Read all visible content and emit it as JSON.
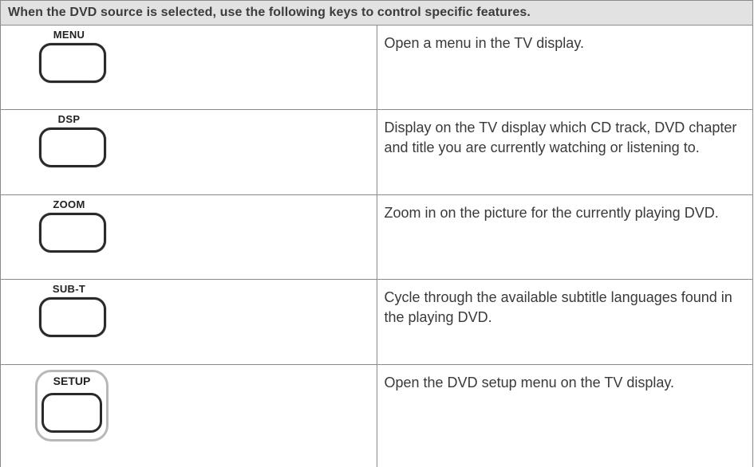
{
  "header": {
    "title": "When the DVD source is selected, use the following keys to control specific features."
  },
  "rows": [
    {
      "key": "MENU",
      "icon": "menu-key-icon",
      "description": "Open a menu in the TV display."
    },
    {
      "key": "DSP",
      "icon": "dsp-key-icon",
      "description": "Display on the TV display which CD track, DVD chapter and title you are currently watching or listening to."
    },
    {
      "key": "ZOOM",
      "icon": "zoom-key-icon",
      "description": "Zoom in on the picture for the currently playing DVD."
    },
    {
      "key": "SUB-T",
      "icon": "subt-key-icon",
      "description": "Cycle through the available subtitle languages found in the playing DVD."
    },
    {
      "key": "SETUP",
      "icon": "setup-key-icon",
      "description": "Open the DVD setup menu on the TV display."
    }
  ],
  "colors": {
    "header_bg": "#e2e2e2",
    "border": "#8a8a8a",
    "text": "#3a3a3a"
  }
}
